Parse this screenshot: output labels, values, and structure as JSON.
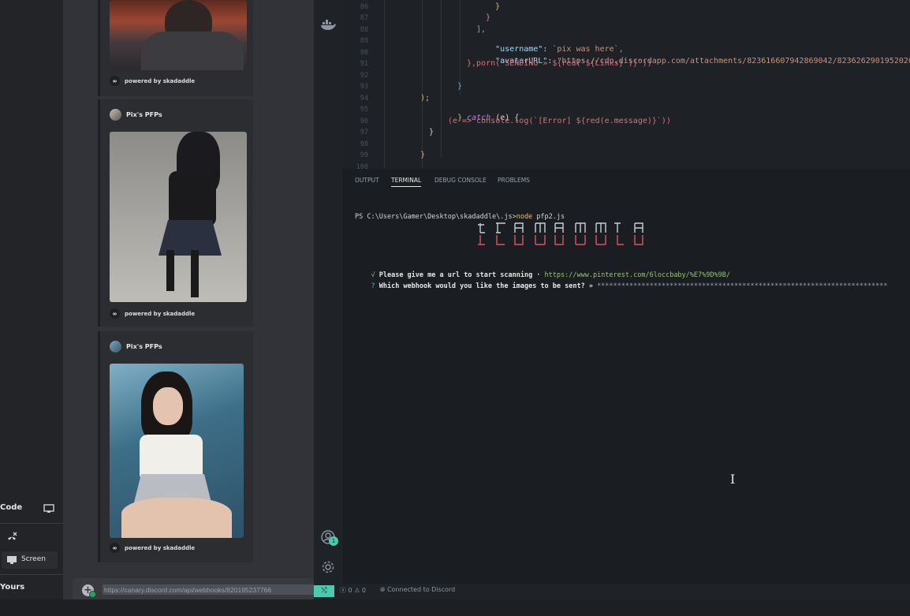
{
  "sidebar": {
    "code_label": "Code",
    "screen_label": "Screen",
    "yours_label": "Yours"
  },
  "feed": {
    "footer_text": "powered by skadaddle",
    "embeds": [
      {
        "author": "Pix's PFPs"
      },
      {
        "author": "Pix's PFPs"
      }
    ]
  },
  "editor": {
    "line_numbers": [
      "86",
      "87",
      "88",
      "89",
      "90",
      "91",
      "92",
      "93",
      "94",
      "95",
      "96",
      "97",
      "98",
      "99",
      "100"
    ],
    "lines": {
      "l86": "}",
      "l87": "}",
      "l88": "],",
      "l89_key": "\"username\"",
      "l89_val": "`pix was here`,",
      "l90_key": "\"avatarURL\"",
      "l90_val": "\"https://cdn.discordapp.com/attachments/823616607942869042/823626290195202048/ima",
      "l91_a": "},porn(`SENDING » ${red(`${Links}`)}`))",
      "l93": "}",
      "l94": ");",
      "l95_a": "} ",
      "l95_catch": "catch",
      "l95_b": " (e) {",
      "l96": "(e => console.log(`[Error] ${red(e.message)}`))",
      "l97": "}",
      "l99": "}"
    }
  },
  "panel": {
    "tabs": [
      "OUTPUT",
      "TERMINAL",
      "DEBUG CONSOLE",
      "PROBLEMS"
    ],
    "active_tab": "TERMINAL",
    "prompt": "PS C:\\Users\\Gamer\\Desktop\\skadaddle\\.js>",
    "command_node": "node",
    "command_rest": " pfp2.js",
    "q1_mark": "√",
    "q1_text": " Please give me a url to start scanning ·",
    "q1_answer": " https://www.pinterest.com/6loccbaby/%E7%9D%9B/",
    "q2_mark": "?",
    "q2_text": " Which webhook would you like the images to be sent? »",
    "q2_answer": " ************************************************************************"
  },
  "statusbar": {
    "errors": "0",
    "warnings": "0",
    "discord": "Connected to Discord",
    "badge": "1"
  },
  "message_input": {
    "value": "https://canary.discord.com/api/webhooks/820195237766"
  },
  "colors": {
    "discord_bg": "#313338",
    "vscode_bg": "#1e2227",
    "accent_green": "#23a55a",
    "remote_teal": "#4ec9b0"
  }
}
